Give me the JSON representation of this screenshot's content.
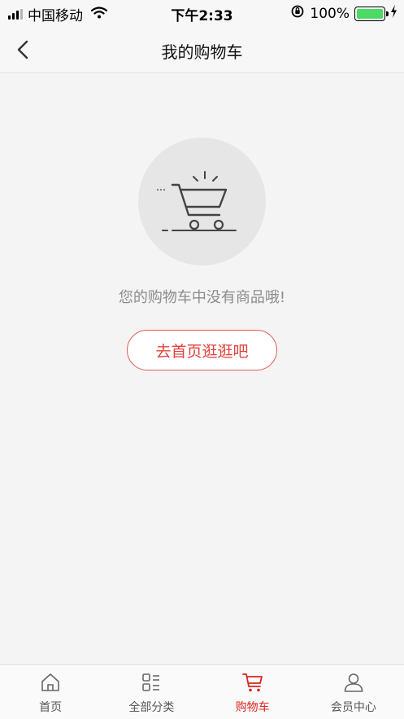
{
  "status_bar": {
    "carrier": "中国移动",
    "time": "下午2:33",
    "battery": "100%",
    "battery_level": 1.0,
    "signal_bars_active": 3,
    "signal_bars_total": 4
  },
  "nav": {
    "title": "我的购物车",
    "back_icon": "chevron-left-icon"
  },
  "empty_state": {
    "icon": "empty-cart-icon",
    "message": "您的购物车中没有商品哦!",
    "button_label": "去首页逛逛吧"
  },
  "tabs": [
    {
      "label": "首页",
      "icon": "home-icon",
      "active": false
    },
    {
      "label": "全部分类",
      "icon": "category-icon",
      "active": false
    },
    {
      "label": "购物车",
      "icon": "cart-icon",
      "active": true
    },
    {
      "label": "会员中心",
      "icon": "user-icon",
      "active": false
    }
  ],
  "colors": {
    "accent": "#d9251d",
    "background": "#f4f4f4",
    "muted_text": "#8c8c8c"
  }
}
